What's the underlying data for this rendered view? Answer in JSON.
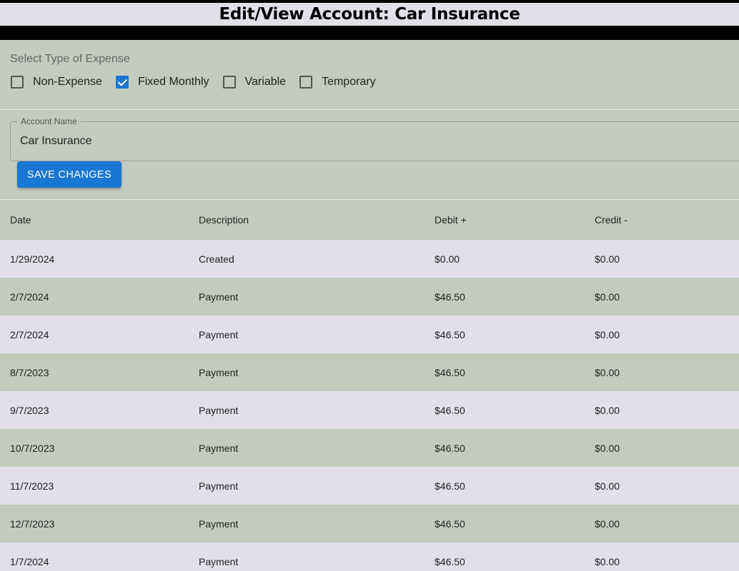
{
  "header": {
    "title": "Edit/View Account: Car Insurance"
  },
  "expense_type": {
    "label": "Select Type of Expense",
    "options": [
      {
        "label": "Non-Expense",
        "checked": false
      },
      {
        "label": "Fixed Monthly",
        "checked": true
      },
      {
        "label": "Variable",
        "checked": false
      },
      {
        "label": "Temporary",
        "checked": false
      }
    ]
  },
  "account": {
    "field_label": "Account Name",
    "value": "Car Insurance",
    "save_label": "SAVE CHANGES"
  },
  "table": {
    "columns": [
      "Date",
      "Description",
      "Debit +",
      "Credit -"
    ],
    "rows": [
      [
        "1/29/2024",
        "Created",
        "$0.00",
        "$0.00"
      ],
      [
        "2/7/2024",
        "Payment",
        "$46.50",
        "$0.00"
      ],
      [
        "2/7/2024",
        "Payment",
        "$46.50",
        "$0.00"
      ],
      [
        "8/7/2023",
        "Payment",
        "$46.50",
        "$0.00"
      ],
      [
        "9/7/2023",
        "Payment",
        "$46.50",
        "$0.00"
      ],
      [
        "10/7/2023",
        "Payment",
        "$46.50",
        "$0.00"
      ],
      [
        "11/7/2023",
        "Payment",
        "$46.50",
        "$0.00"
      ],
      [
        "12/7/2023",
        "Payment",
        "$46.50",
        "$0.00"
      ],
      [
        "1/7/2024",
        "Payment",
        "$46.50",
        "$0.00"
      ]
    ]
  },
  "colors": {
    "primary": "#1976d2",
    "background": "#c3cbbf",
    "row_alt": "#e2dfe9"
  }
}
